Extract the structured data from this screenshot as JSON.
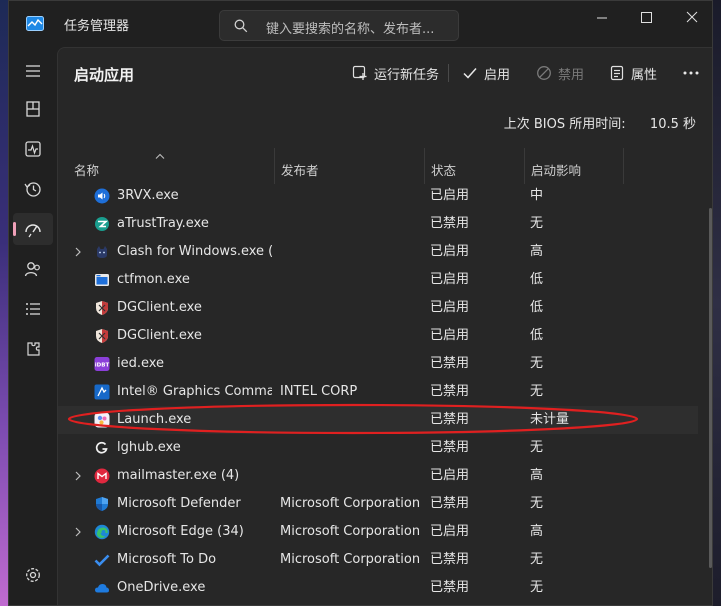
{
  "window": {
    "title": "任务管理器",
    "search_placeholder": "键入要搜索的名称、发布者..."
  },
  "nav": {
    "items": [
      {
        "name": "hamburger-menu-icon"
      },
      {
        "name": "processes-icon"
      },
      {
        "name": "performance-icon"
      },
      {
        "name": "app-history-icon"
      },
      {
        "name": "startup-apps-icon",
        "active": true
      },
      {
        "name": "users-icon"
      },
      {
        "name": "details-icon"
      },
      {
        "name": "services-icon"
      },
      {
        "name": "settings-icon"
      }
    ]
  },
  "page": {
    "title": "启动应用",
    "bios_label": "上次 BIOS 所用时间:",
    "bios_value": "10.5 秒"
  },
  "toolbar": {
    "run_new_task": "运行新任务",
    "enable": "启用",
    "disable": "禁用",
    "properties": "属性",
    "more": "..."
  },
  "table": {
    "headers": {
      "name": "名称",
      "publisher": "发布者",
      "status": "状态",
      "impact": "启动影响"
    },
    "rows": [
      {
        "name": "3RVX.exe",
        "publisher": "",
        "status": "已启用",
        "impact": "中",
        "expandable": false,
        "icon": "speaker-app-icon"
      },
      {
        "name": "aTrustTray.exe",
        "publisher": "",
        "status": "已禁用",
        "impact": "无",
        "expandable": false,
        "icon": "atrust-app-icon"
      },
      {
        "name": "Clash for Windows.exe (…",
        "publisher": "",
        "status": "已启用",
        "impact": "高",
        "expandable": true,
        "icon": "clash-cat-icon"
      },
      {
        "name": "ctfmon.exe",
        "publisher": "",
        "status": "已启用",
        "impact": "低",
        "expandable": false,
        "icon": "window-app-icon"
      },
      {
        "name": "DGClient.exe",
        "publisher": "",
        "status": "已启用",
        "impact": "低",
        "expandable": false,
        "icon": "shield-app-icon"
      },
      {
        "name": "DGClient.exe",
        "publisher": "",
        "status": "已启用",
        "impact": "低",
        "expandable": false,
        "icon": "shield-app-icon"
      },
      {
        "name": "ied.exe",
        "publisher": "",
        "status": "已禁用",
        "impact": "无",
        "expandable": false,
        "icon": "ied-app-icon"
      },
      {
        "name": "Intel® Graphics Comma…",
        "publisher": "INTEL CORP",
        "status": "已禁用",
        "impact": "无",
        "expandable": false,
        "icon": "intel-graphics-icon"
      },
      {
        "name": "Launch.exe",
        "publisher": "",
        "status": "已禁用",
        "impact": "未计量",
        "expandable": false,
        "icon": "launch-app-icon",
        "highlighted": true
      },
      {
        "name": "lghub.exe",
        "publisher": "",
        "status": "已禁用",
        "impact": "无",
        "expandable": false,
        "icon": "logitech-g-icon"
      },
      {
        "name": "mailmaster.exe (4)",
        "publisher": "",
        "status": "已启用",
        "impact": "高",
        "expandable": true,
        "icon": "mailmaster-icon"
      },
      {
        "name": "Microsoft Defender",
        "publisher": "Microsoft Corporation",
        "status": "已禁用",
        "impact": "无",
        "expandable": false,
        "icon": "defender-shield-icon"
      },
      {
        "name": "Microsoft Edge (34)",
        "publisher": "Microsoft Corporation",
        "status": "已启用",
        "impact": "高",
        "expandable": true,
        "icon": "edge-browser-icon"
      },
      {
        "name": "Microsoft To Do",
        "publisher": "Microsoft Corporation",
        "status": "已禁用",
        "impact": "无",
        "expandable": false,
        "icon": "todo-check-icon"
      },
      {
        "name": "OneDrive.exe",
        "publisher": "",
        "status": "已禁用",
        "impact": "无",
        "expandable": false,
        "icon": "onedrive-cloud-icon"
      }
    ]
  },
  "colors": {
    "accent": "#f0a0b8",
    "annotation": "#e02020"
  }
}
